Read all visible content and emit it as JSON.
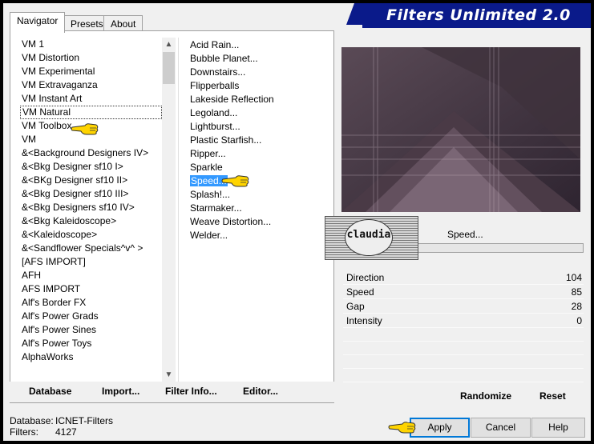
{
  "title": "Filters Unlimited 2.0",
  "tabs": [
    {
      "label": "Navigator",
      "active": true
    },
    {
      "label": "Presets",
      "active": false
    },
    {
      "label": "About",
      "active": false
    }
  ],
  "categories": [
    {
      "label": "VM 1"
    },
    {
      "label": "VM Distortion"
    },
    {
      "label": "VM Experimental"
    },
    {
      "label": "VM Extravaganza"
    },
    {
      "label": "VM Instant Art"
    },
    {
      "label": "VM Natural",
      "selected": true
    },
    {
      "label": "VM Toolbox"
    },
    {
      "label": "VM"
    },
    {
      "label": "&<Background Designers IV>"
    },
    {
      "label": "&<Bkg Designer sf10 I>"
    },
    {
      "label": "&<BKg Designer sf10 II>"
    },
    {
      "label": "&<Bkg Designer sf10 III>"
    },
    {
      "label": "&<Bkg Designers sf10 IV>"
    },
    {
      "label": "&<Bkg Kaleidoscope>"
    },
    {
      "label": "&<Kaleidoscope>"
    },
    {
      "label": "&<Sandflower Specials^v^ >"
    },
    {
      "label": "[AFS IMPORT]"
    },
    {
      "label": "AFH"
    },
    {
      "label": "AFS IMPORT"
    },
    {
      "label": "Alf's Border FX"
    },
    {
      "label": "Alf's Power Grads"
    },
    {
      "label": "Alf's Power Sines"
    },
    {
      "label": "Alf's Power Toys"
    },
    {
      "label": "AlphaWorks"
    }
  ],
  "filters": [
    {
      "label": "Acid Rain..."
    },
    {
      "label": "Bubble Planet..."
    },
    {
      "label": "Downstairs..."
    },
    {
      "label": "Flipperballs"
    },
    {
      "label": "Lakeside Reflection"
    },
    {
      "label": "Legoland..."
    },
    {
      "label": "Lightburst..."
    },
    {
      "label": "Plastic Starfish..."
    },
    {
      "label": "Ripper..."
    },
    {
      "label": "Sparkle"
    },
    {
      "label": "Speed...",
      "selected": true
    },
    {
      "label": "Splash!..."
    },
    {
      "label": "Starmaker..."
    },
    {
      "label": "Weave Distortion..."
    },
    {
      "label": "Welder..."
    }
  ],
  "left_buttons": {
    "database": "Database",
    "import": "Import...",
    "filter_info": "Filter Info...",
    "editor": "Editor..."
  },
  "current_filter": "Speed...",
  "watermark_text": "claudia",
  "params": [
    {
      "name": "Direction",
      "value": "104"
    },
    {
      "name": "Speed",
      "value": "85"
    },
    {
      "name": "Gap",
      "value": "28"
    },
    {
      "name": "Intensity",
      "value": "0"
    }
  ],
  "right_buttons": {
    "randomize": "Randomize",
    "reset": "Reset"
  },
  "status": {
    "database_label": "Database:",
    "database_value": "ICNET-Filters",
    "filters_label": "Filters:",
    "filters_value": "4127"
  },
  "dialog_buttons": {
    "apply": "Apply",
    "cancel": "Cancel",
    "help": "Help"
  },
  "colors": {
    "banner": "#0a1a8a",
    "selection": "#3399ff",
    "preview_bg": "#3b2e38"
  }
}
